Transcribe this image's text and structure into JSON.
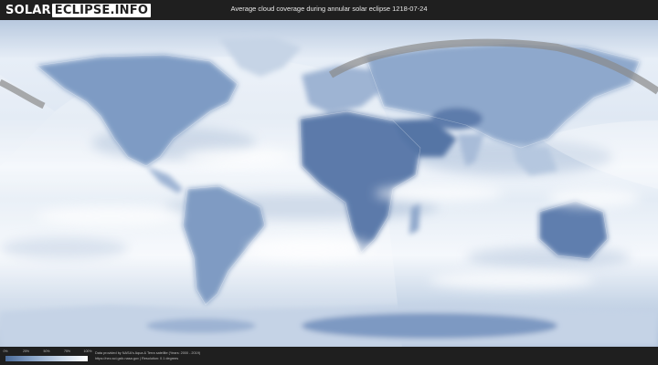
{
  "header": {
    "logo_left": "SOLAR",
    "logo_right": "ECLIPSE.INFO",
    "title": "Average cloud coverage during annular solar eclipse 1218-07-24"
  },
  "legend": {
    "ticks": [
      "0%",
      "25%",
      "50%",
      "75%",
      "100%"
    ],
    "colors": {
      "low": "#4a6a98",
      "mid": "#8aa5c8",
      "high": "#ffffff"
    }
  },
  "credits": {
    "line1": "Data provided by NASA's Aqua & Terra satellite (Years: 2000 - 2019)",
    "line2": "https://neo.sci.gsfc.nasa.gov | Resolution: 0.1 degrees"
  },
  "colors": {
    "background": "#1f1f1f",
    "cloud": "#f2f6fb",
    "clear_sky": "#5a7bab",
    "eclipse_path": "#8a8a8a"
  }
}
